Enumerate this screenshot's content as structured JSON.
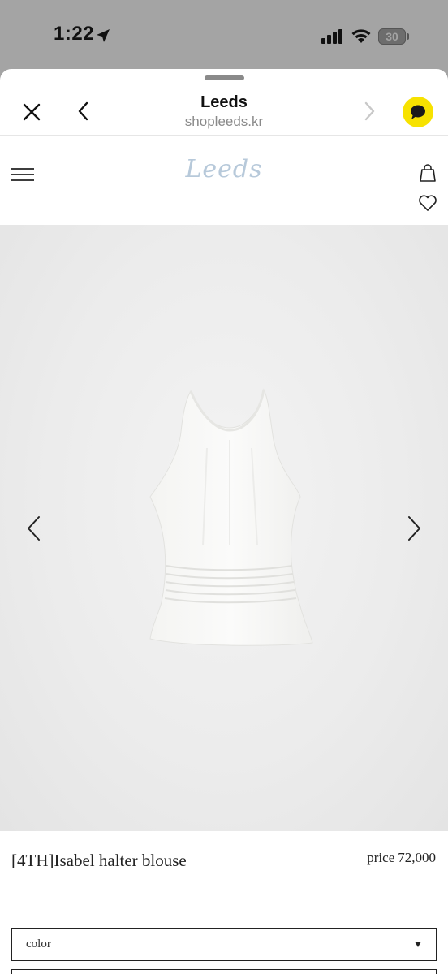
{
  "status_bar": {
    "time": "1:22",
    "battery": "30",
    "icons": [
      "location-arrow-icon",
      "signal-icon",
      "wifi-icon",
      "battery-icon"
    ]
  },
  "browser": {
    "title": "Leeds",
    "url": "shopleeds.kr",
    "icons": [
      "close-icon",
      "back-icon",
      "forward-icon",
      "kakao-chat-icon"
    ],
    "kakao_color": "#f7e200"
  },
  "site": {
    "logo": "Leeds",
    "logo_color": "#b7c9da",
    "icons": [
      "menu-icon",
      "bag-icon",
      "heart-icon"
    ]
  },
  "product": {
    "name": "[4TH]Isabel halter blouse",
    "price_label": "price",
    "price": "72,000",
    "gallery_icons": [
      "chevron-left-icon",
      "chevron-right-icon"
    ]
  },
  "options": {
    "color_label": "color"
  }
}
